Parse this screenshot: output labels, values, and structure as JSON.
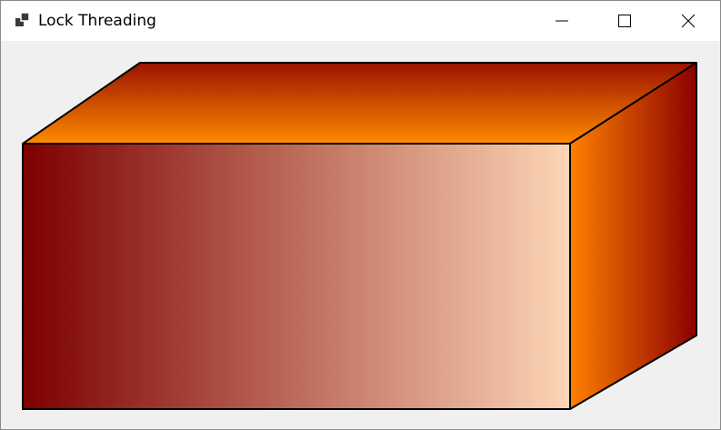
{
  "window": {
    "title": "Lock Threading",
    "app_icon": "app-window-icon",
    "controls": {
      "minimize_icon": "minimize-icon",
      "maximize_icon": "maximize-icon",
      "close_icon": "close-icon"
    }
  },
  "scene": {
    "shape": "3d-box",
    "colors": {
      "front_left": "#7c0000",
      "front_right": "#fdd6b6",
      "top_back": "#9a1200",
      "top_front": "#ff8a00",
      "side_left": "#ff8000",
      "side_right": "#8b0000",
      "outline": "#000000",
      "background": "#f0f0f0"
    }
  }
}
